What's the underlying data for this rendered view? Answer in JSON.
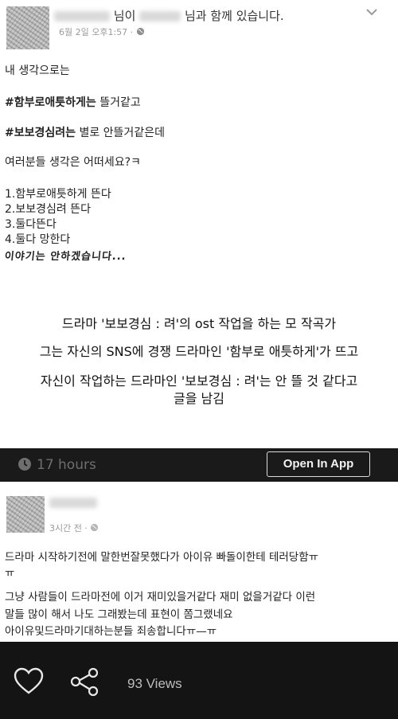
{
  "post1": {
    "header_suffix_1": "님이",
    "header_suffix_2": "님과 함께 있습니다.",
    "timestamp": "6월 2일 오후1:57",
    "dot": "·",
    "lines": {
      "l1": "내 생각으로는",
      "l2_bold": "#함부로애틋하게는",
      "l2_rest": " 뜰거같고",
      "l3_bold": "#보보경심려는",
      "l3_rest": " 별로 안뜰거같은데",
      "l4": "여러분들 생각은 어떠세요?ㅋ",
      "opt1": "1.함부로애틋하게 뜬다",
      "opt2": "2.보보경심려 뜬다",
      "opt3": "3.둘다뜬다",
      "opt4": "4.둘다 망한다",
      "hand": "이야기는 안하겠습니다..."
    }
  },
  "caption": {
    "c1": "드라마 '보보경심 : 려'의 ost 작업을 하는 모 작곡가",
    "c2": "그는 자신의 SNS에 경쟁 드라마인 '함부로 애틋하게'가 뜨고",
    "c3": "자신이 작업하는 드라마인 '보보경심 : 려'는 안 뜰 것 같다고",
    "c4": "글을 남김"
  },
  "bar1": {
    "time_label": "17 hours",
    "open_app_label": "Open In App"
  },
  "post2": {
    "timestamp": "3시간 전 ·",
    "lines": {
      "a": "드라마 시작하기전에 말한번잘못했다가 아이유 빠돌이한테 테러당함ㅠ",
      "b": "ㅠ",
      "c": "그냥 사람들이 드라마전에 이거 재미있을거같다 재미 없을거같다 이런",
      "d": "말들 많이 해서 나도 그래봤는데 표현이 쫌그랬네요",
      "e": "아이유및드라마기대하는분들 죄송합니다ㅠ—ㅠ"
    }
  },
  "bar2": {
    "views_label": "93 Views"
  },
  "icons": {
    "chevron": "chevron-down-icon",
    "globe": "globe-icon",
    "clock": "clock-icon",
    "heart": "heart-icon",
    "share": "share-icon"
  },
  "colors": {
    "dark_bar": "#1a1a1a",
    "bottom_bar": "#141414",
    "muted_text": "#9a9a9a"
  }
}
